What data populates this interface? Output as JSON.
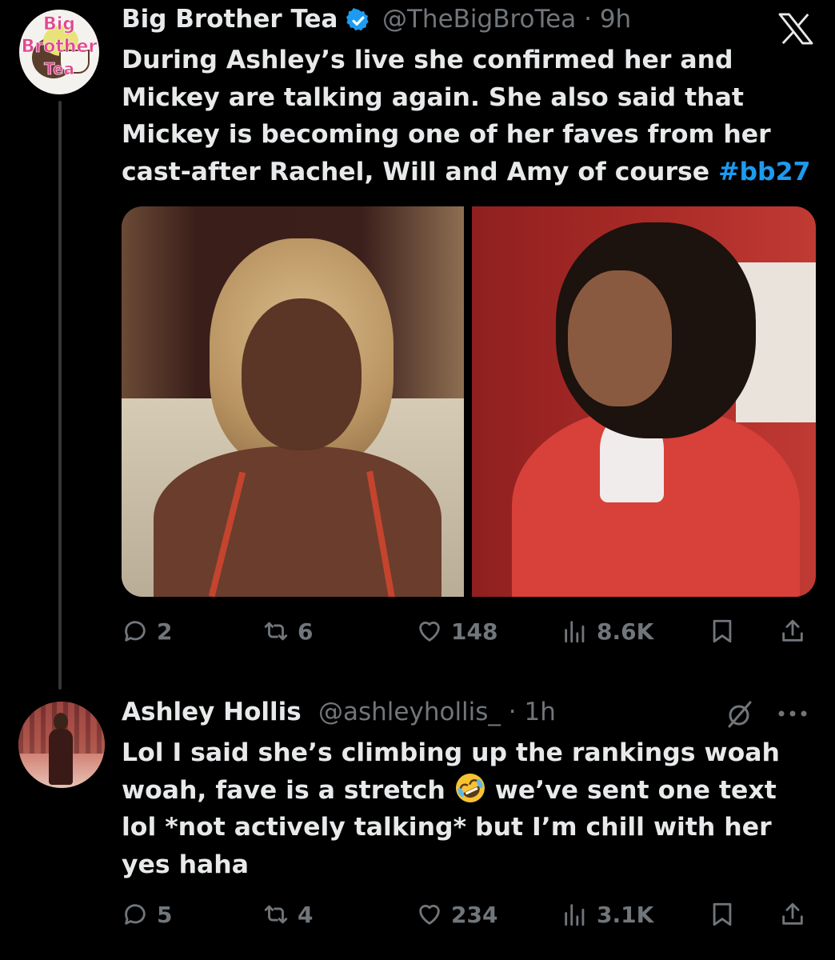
{
  "tweet": {
    "author_name": "Big Brother Tea",
    "handle": "@TheBigBroTea",
    "separator": "·",
    "time": "9h",
    "avatar_text": [
      "Big",
      "Brother",
      "Tea"
    ],
    "text_lines": [
      "During Ashley’s live she confirmed her and",
      "Mickey are talking again. She also said that",
      "Mickey is becoming one of her faves from her",
      "cast-after Rachel, Will and Amy of course "
    ],
    "hashtag": "#bb27",
    "media_icon_names": [
      "photo-woman-blonde-braids",
      "photo-woman-red-hoodie"
    ],
    "actions": {
      "replies": "2",
      "retweets": "6",
      "likes": "148",
      "views": "8.6K"
    }
  },
  "reply": {
    "author_name": "Ashley Hollis",
    "handle": "@ashleyhollis_",
    "separator": "·",
    "time": "1h",
    "text_lines": [
      "Lol I said she’s climbing up the rankings woah",
      "woah, fave is a stretch ",
      " we’ve sent one text",
      "lol *not actively talking* but I’m chill with her",
      "yes haha"
    ],
    "emoji": "rolling-on-the-floor-laughing",
    "actions": {
      "replies": "5",
      "retweets": "4",
      "likes": "234",
      "views": "3.1K"
    }
  },
  "icons": {
    "platform": "x-logo",
    "verified": "verified-badge-icon",
    "muted": "muted-icon",
    "more": "more-icon"
  },
  "colors": {
    "background": "#000000",
    "text": "#e7e9ea",
    "muted_text": "#71767b",
    "link": "#1d9bf0",
    "verified": "#1d9bf0"
  }
}
